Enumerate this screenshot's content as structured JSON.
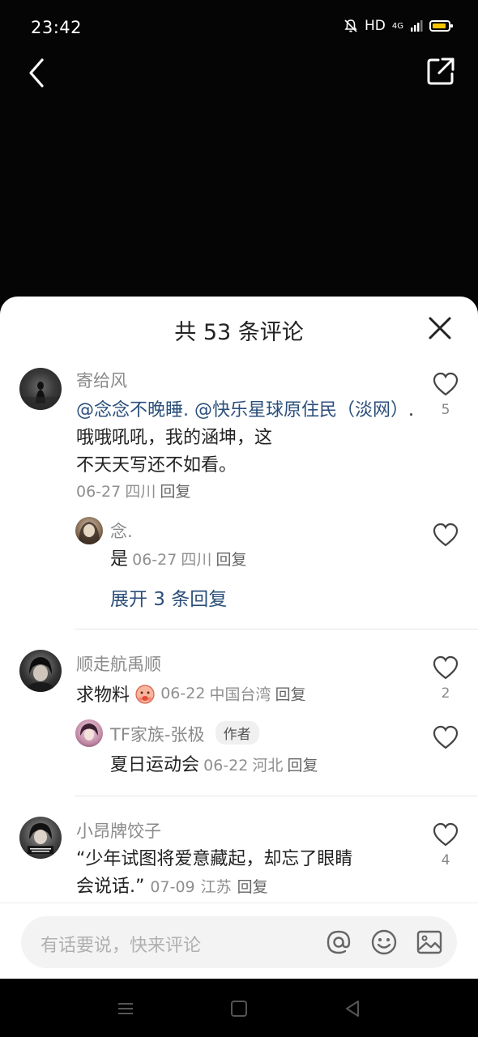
{
  "status_bar": {
    "time": "23:42",
    "network": "HD",
    "signal": "4G"
  },
  "header": {
    "back_icon": "chevron-left-icon",
    "share_icon": "share-icon"
  },
  "sheet": {
    "title": "共 53 条评论",
    "close_icon": "close-icon"
  },
  "comments": [
    {
      "username": "寄给风",
      "mention1": "@念念不晚睡.",
      "mention2": "@快乐星球原住民（淡网）",
      "text_line1_tail": ". 哦哦吼吼，我的涵坤，这",
      "text_line2": "不天天写还不如看。",
      "date": "06-27",
      "location": "四川",
      "reply_label": "回复",
      "likes": "5",
      "replies": [
        {
          "username": "念.",
          "text": "是",
          "date": "06-27",
          "location": "四川",
          "reply_label": "回复"
        }
      ],
      "expand_label": "展开 3 条回复"
    },
    {
      "username": "顺走航禹顺",
      "text": "求物料",
      "date": "06-22",
      "location": "中国台湾",
      "reply_label": "回复",
      "likes": "2",
      "replies": [
        {
          "username": "TF家族-张极",
          "badge": "作者",
          "text": "夏日运动会",
          "date": "06-22",
          "location": "河北",
          "reply_label": "回复"
        }
      ]
    },
    {
      "username": "小昂牌饺子",
      "text_line1": "“少年试图将爱意藏起，却忘了眼睛",
      "text_line2": "会说话.”",
      "date": "07-09",
      "location": "江苏",
      "reply_label": "回复",
      "likes": "4"
    }
  ],
  "input_bar": {
    "placeholder": "有话要说，快来评论",
    "icons": [
      "at-icon",
      "emoji-icon",
      "image-icon"
    ]
  },
  "colors": {
    "mention": "#2b4f7b",
    "battery": "#f5c400",
    "sheet_bg": "#ffffff"
  }
}
